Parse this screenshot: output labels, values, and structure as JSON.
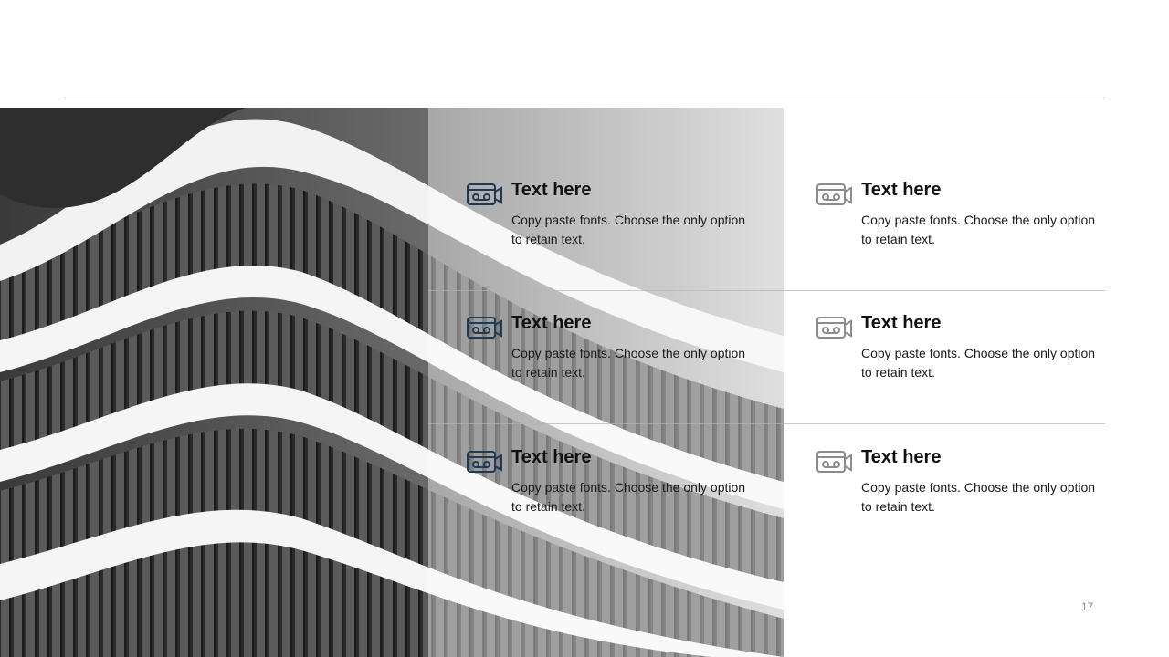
{
  "items": [
    {
      "title": "Text here",
      "body": "Copy paste fonts. Choose the only option to retain text.",
      "icon": "cassette-camera-icon",
      "icon_color": "#1f3a55"
    },
    {
      "title": "Text here",
      "body": "Copy paste fonts. Choose the only option to retain text.",
      "icon": "cassette-camera-icon",
      "icon_color": "#8c8c8c"
    },
    {
      "title": "Text here",
      "body": "Copy paste fonts. Choose the only option to retain text.",
      "icon": "cassette-camera-icon",
      "icon_color": "#1f3a55"
    },
    {
      "title": "Text here",
      "body": "Copy paste fonts. Choose the only option to retain text.",
      "icon": "cassette-camera-icon",
      "icon_color": "#8c8c8c"
    },
    {
      "title": "Text here",
      "body": "Copy paste fonts. Choose the only option to retain text.",
      "icon": "cassette-camera-icon",
      "icon_color": "#1f3a55"
    },
    {
      "title": "Text here",
      "body": "Copy paste fonts. Choose the only option to retain text.",
      "icon": "cassette-camera-icon",
      "icon_color": "#8c8c8c"
    }
  ],
  "page_number": "17",
  "colors": {
    "icon_dark": "#1f3a55",
    "icon_light": "#8c8c8c",
    "rule": "#b0b0b0"
  }
}
